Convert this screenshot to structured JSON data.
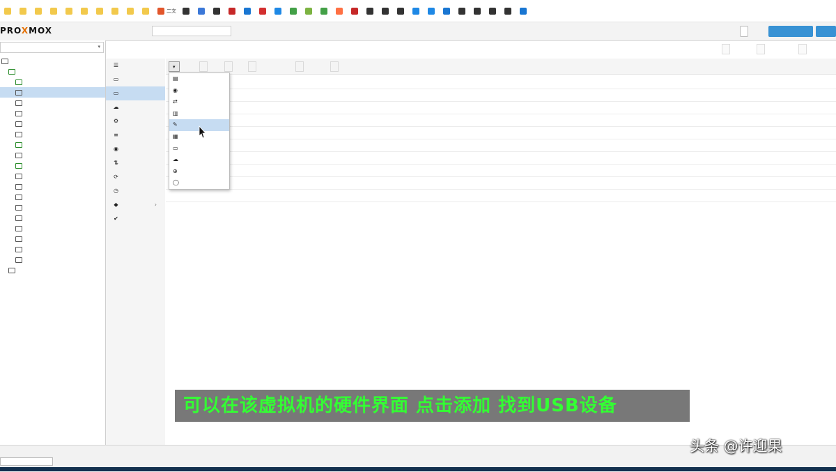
{
  "bookmarks": [
    {
      "label": "",
      "color": "#f2c94c"
    },
    {
      "label": "",
      "color": "#f2c94c"
    },
    {
      "label": "",
      "color": "#f2c94c"
    },
    {
      "label": "",
      "color": "#f2c94c"
    },
    {
      "label": "",
      "color": "#f2c94c"
    },
    {
      "label": "",
      "color": "#f2c94c"
    },
    {
      "label": "",
      "color": "#f2c94c"
    },
    {
      "label": "",
      "color": "#f2c94c"
    },
    {
      "label": "",
      "color": "#f2c94c"
    },
    {
      "label": "",
      "color": "#f2c94c"
    },
    {
      "label": "二文",
      "color": "#e2562b"
    },
    {
      "label": "",
      "color": "#333333"
    },
    {
      "label": "",
      "color": "#3b78d8"
    },
    {
      "label": "",
      "color": "#333333"
    },
    {
      "label": "",
      "color": "#c62828"
    },
    {
      "label": "",
      "color": "#1976d2"
    },
    {
      "label": "",
      "color": "#d32f2f"
    },
    {
      "label": "",
      "color": "#1e88e5"
    },
    {
      "label": "",
      "color": "#43a047"
    },
    {
      "label": "",
      "color": "#7cb342"
    },
    {
      "label": "",
      "color": "#43a047"
    },
    {
      "label": "",
      "color": "#ff7043"
    },
    {
      "label": "",
      "color": "#c62828"
    },
    {
      "label": "",
      "color": "#333333"
    },
    {
      "label": "",
      "color": "#333333"
    },
    {
      "label": "",
      "color": "#333333"
    },
    {
      "label": "",
      "color": "#1e88e5"
    },
    {
      "label": "",
      "color": "#1e88e5"
    },
    {
      "label": "",
      "color": "#1976d2"
    },
    {
      "label": "",
      "color": "#333333"
    },
    {
      "label": "",
      "color": "#333333"
    },
    {
      "label": "",
      "color": "#333333"
    },
    {
      "label": "",
      "color": "#333333"
    },
    {
      "label": "",
      "color": "#1976d2"
    }
  ],
  "header": {
    "logo_main": "PRO",
    "logo_x": "X",
    "logo_rest": "MOX",
    "version": "",
    "search_placeholder": "",
    "doc_btn": "",
    "create_vm_btn": "",
    "create_ct_btn": ""
  },
  "tree": {
    "view_label": "",
    "items": [
      {
        "label": "",
        "indent": 0,
        "icon": "folder",
        "selected": false
      },
      {
        "label": "",
        "indent": 1,
        "icon": "node",
        "selected": false
      },
      {
        "label": "",
        "indent": 2,
        "icon": "vm-running",
        "selected": false
      },
      {
        "label": "",
        "indent": 2,
        "icon": "vm",
        "selected": true
      },
      {
        "label": "",
        "indent": 2,
        "icon": "vm",
        "selected": false
      },
      {
        "label": "",
        "indent": 2,
        "icon": "vm",
        "selected": false
      },
      {
        "label": "",
        "indent": 2,
        "icon": "vm",
        "selected": false
      },
      {
        "label": "",
        "indent": 2,
        "icon": "vm",
        "selected": false
      },
      {
        "label": "",
        "indent": 2,
        "icon": "vm-running",
        "selected": false
      },
      {
        "label": "",
        "indent": 2,
        "icon": "vm",
        "selected": false
      },
      {
        "label": "",
        "indent": 2,
        "icon": "vm-running",
        "selected": false
      },
      {
        "label": "",
        "indent": 2,
        "icon": "vm",
        "selected": false
      },
      {
        "label": "",
        "indent": 2,
        "icon": "vm",
        "selected": false
      },
      {
        "label": "",
        "indent": 2,
        "icon": "vm",
        "selected": false
      },
      {
        "label": "",
        "indent": 2,
        "icon": "vm",
        "selected": false
      },
      {
        "label": "",
        "indent": 2,
        "icon": "vm",
        "selected": false
      },
      {
        "label": "",
        "indent": 2,
        "icon": "vm",
        "selected": false
      },
      {
        "label": "",
        "indent": 2,
        "icon": "vm",
        "selected": false
      },
      {
        "label": "",
        "indent": 2,
        "icon": "vm",
        "selected": false
      },
      {
        "label": "",
        "indent": 2,
        "icon": "vm",
        "selected": false
      },
      {
        "label": "",
        "indent": 1,
        "icon": "storage",
        "selected": false
      }
    ]
  },
  "breadcrumb": "",
  "right_buttons": {
    "start": "",
    "shutdown": "",
    "console": ""
  },
  "nav": {
    "items": [
      {
        "label": "",
        "icon": "summary-icon",
        "glyph": "☰",
        "selected": false
      },
      {
        "label": "",
        "icon": "console-icon",
        "glyph": "▭",
        "selected": false
      },
      {
        "label": "",
        "icon": "hardware-icon",
        "glyph": "▭",
        "selected": true
      },
      {
        "label": "",
        "icon": "cloud-init-icon",
        "glyph": "☁",
        "selected": false
      },
      {
        "label": "",
        "icon": "options-icon",
        "glyph": "⚙",
        "selected": false
      },
      {
        "label": "",
        "icon": "task-history-icon",
        "glyph": "≡",
        "selected": false
      },
      {
        "label": "",
        "icon": "monitor-icon",
        "glyph": "◉",
        "selected": false
      },
      {
        "label": "",
        "icon": "backup-icon",
        "glyph": "⇅",
        "selected": false
      },
      {
        "label": "",
        "icon": "replication-icon",
        "glyph": "⟳",
        "selected": false
      },
      {
        "label": "",
        "icon": "snapshot-icon",
        "glyph": "◷",
        "selected": false
      },
      {
        "label": "",
        "icon": "firewall-icon",
        "glyph": "◆",
        "selected": false,
        "chevron": true
      },
      {
        "label": "",
        "icon": "permissions-icon",
        "glyph": "✔",
        "selected": false
      }
    ]
  },
  "toolbar": {
    "add": "",
    "remove": "",
    "edit": "",
    "resize": "",
    "move": "",
    "revert": ""
  },
  "grid": {
    "rows": [
      {
        "key": "",
        "value": ""
      },
      {
        "key": "",
        "value": ""
      },
      {
        "key": "",
        "value": ""
      },
      {
        "key": "",
        "value": ""
      },
      {
        "key": "",
        "value": ""
      },
      {
        "key": "",
        "value": ""
      },
      {
        "key": "",
        "value": ""
      },
      {
        "key": "",
        "value": ""
      },
      {
        "key": "",
        "value": ""
      },
      {
        "key": "",
        "value": ""
      }
    ]
  },
  "add_menu": {
    "items": [
      {
        "label": "",
        "glyph": "▤",
        "highlighted": false
      },
      {
        "label": "",
        "glyph": "◉",
        "highlighted": false
      },
      {
        "label": "",
        "glyph": "⇄",
        "highlighted": false
      },
      {
        "label": "",
        "glyph": "▥",
        "highlighted": false
      },
      {
        "label": "",
        "glyph": "✎",
        "highlighted": true
      },
      {
        "label": "",
        "glyph": "▦",
        "highlighted": false
      },
      {
        "label": "",
        "glyph": "▭",
        "highlighted": false
      },
      {
        "label": "",
        "glyph": "☁",
        "highlighted": false
      },
      {
        "label": "",
        "glyph": "⊕",
        "highlighted": false
      },
      {
        "label": "",
        "glyph": "◯",
        "highlighted": false
      }
    ]
  },
  "subtitle": "可以在该虚拟机的硬件界面 点击添加 找到USB设备",
  "tasks_label": "",
  "task_tab": "",
  "watermark": "头条 @许迎果"
}
